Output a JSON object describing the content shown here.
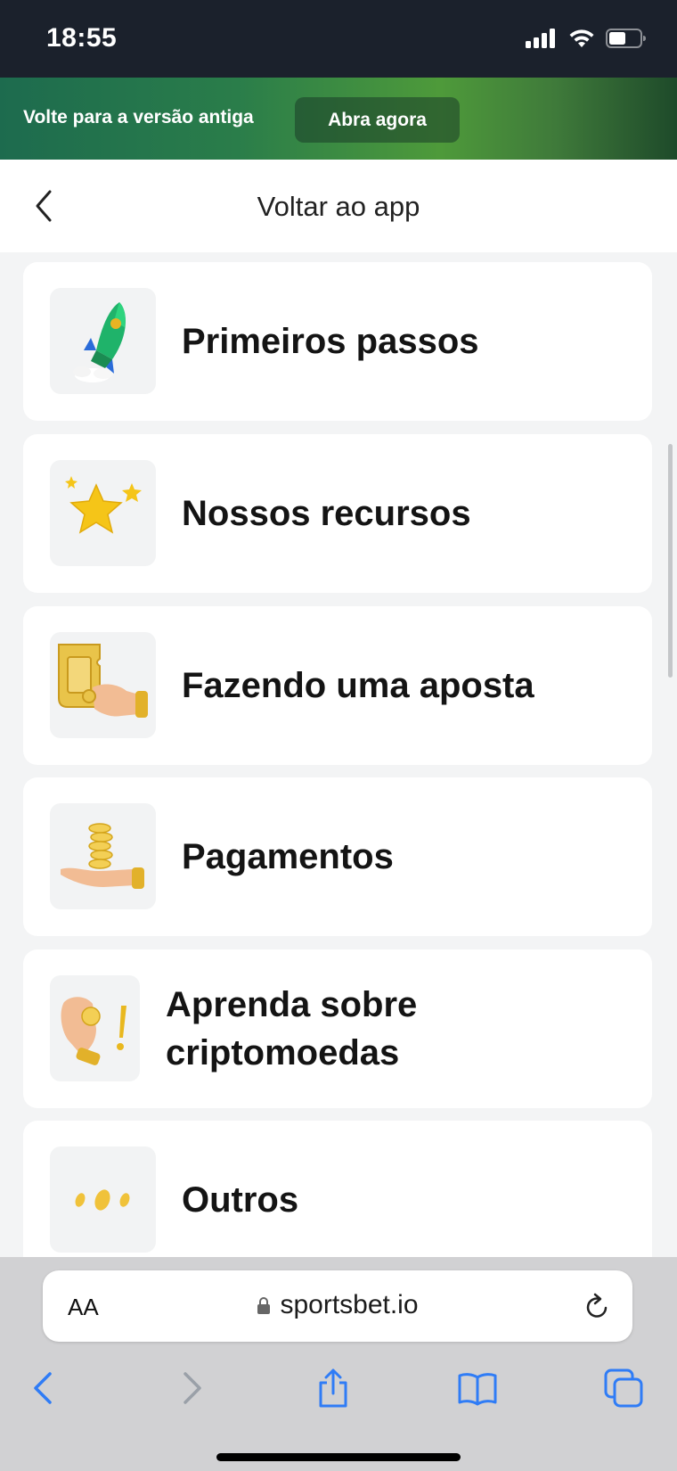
{
  "status_bar": {
    "time": "18:55"
  },
  "promo": {
    "text": "Volte para a versão antiga",
    "button": "Abra agora"
  },
  "nav": {
    "title": "Voltar ao app"
  },
  "categories": [
    {
      "label": "Primeiros passos",
      "icon": "rocket-icon"
    },
    {
      "label": "Nossos recursos",
      "icon": "stars-icon"
    },
    {
      "label": "Fazendo uma aposta",
      "icon": "bet-ticket-icon"
    },
    {
      "label": "Pagamentos",
      "icon": "coins-hand-icon"
    },
    {
      "label": "Aprenda sobre criptomoedas",
      "icon": "crypto-hand-icon"
    },
    {
      "label": "Outros",
      "icon": "dots-icon"
    }
  ],
  "browser": {
    "aa": "AA",
    "url": "sportsbet.io"
  },
  "colors": {
    "status_bar_bg": "#1b212c",
    "page_bg": "#f3f4f5",
    "accent_blue": "#2f7cf6",
    "promo_green": "#4e9a3a"
  }
}
